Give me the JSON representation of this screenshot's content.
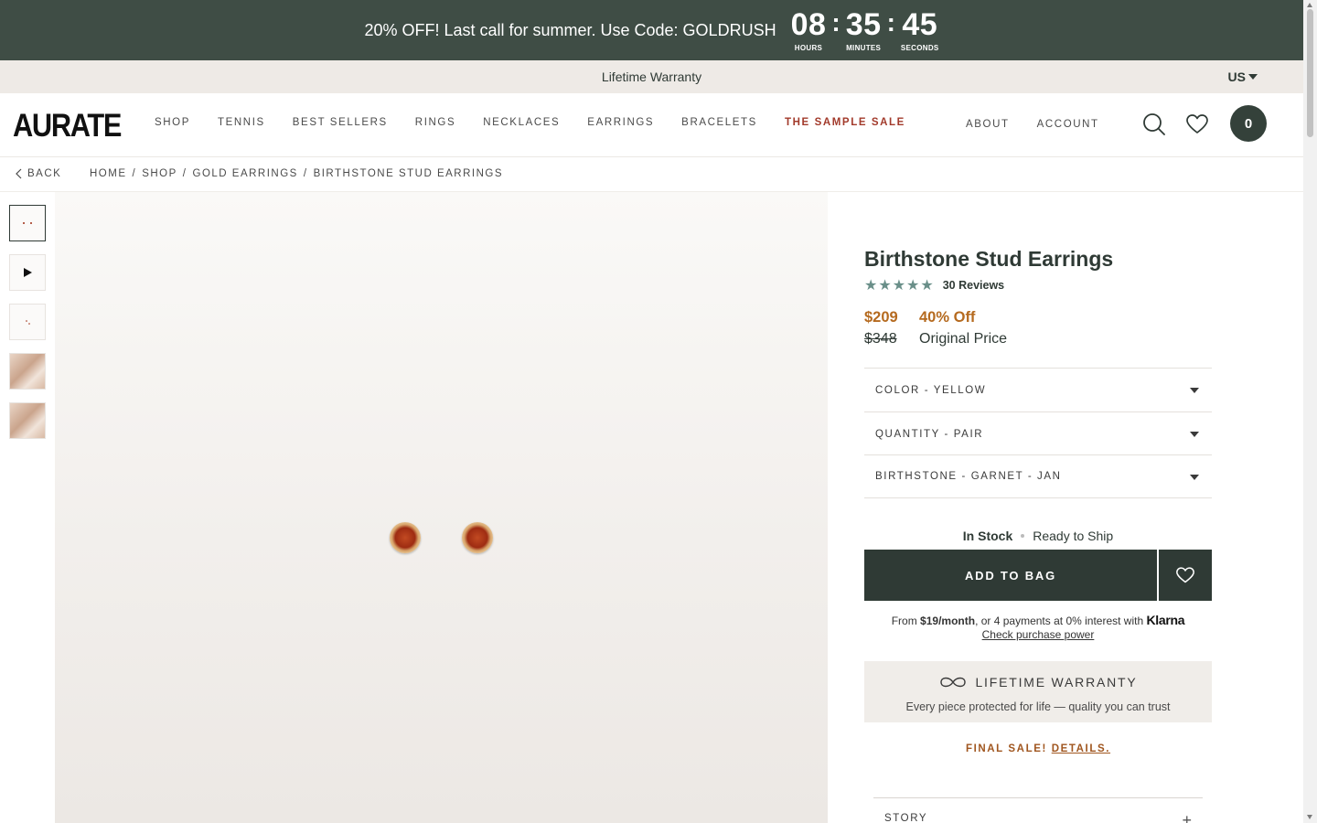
{
  "promo": {
    "text": "20% OFF! Last call for summer. Use Code: GOLDRUSH",
    "hours": "08",
    "minutes": "35",
    "seconds": "45",
    "hours_label": "HOURS",
    "minutes_label": "MINUTES",
    "seconds_label": "SECONDS",
    "separator": ":"
  },
  "strip": {
    "text": "Lifetime Warranty",
    "locale": "US"
  },
  "header": {
    "logo": "AURATE",
    "nav": [
      "SHOP",
      "TENNIS",
      "BEST SELLERS",
      "RINGS",
      "NECKLACES",
      "EARRINGS",
      "BRACELETS",
      "THE SAMPLE SALE"
    ],
    "secondary_nav": [
      "ABOUT",
      "ACCOUNT"
    ],
    "bag_count": "0",
    "icons": [
      "search-icon",
      "heart-icon",
      "bag-icon"
    ]
  },
  "breadcrumb": {
    "back": "BACK",
    "items": [
      "HOME",
      "SHOP",
      "GOLD EARRINGS",
      "BIRTHSTONE STUD EARRINGS"
    ],
    "separator": "/"
  },
  "product": {
    "title": "Birthstone Stud Earrings",
    "rating_stars": 5,
    "reviews": "30 Reviews",
    "price": "$209",
    "discount": "40% Off",
    "original_price": "$348",
    "original_label": "Original Price",
    "options": [
      "COLOR - YELLOW",
      "QUANTITY - PAIR",
      "BIRTHSTONE - GARNET - JAN"
    ],
    "stock_status": "In Stock",
    "ship_status": "Ready to Ship",
    "add_to_bag": "ADD TO BAG",
    "klarna_prefix": "From",
    "klarna_amount": "$19/month",
    "klarna_suffix": ", or 4 payments at 0% interest with",
    "klarna_brand": "Klarna",
    "klarna_link": "Check purchase power",
    "warranty_title": "LIFETIME WARRANTY",
    "warranty_sub": "Every piece protected for life — quality you can trust",
    "final_sale": "FINAL SALE!",
    "final_sale_link": "DETAILS.",
    "story": "STORY"
  },
  "colors": {
    "promo_bg": "#3f4d45",
    "primary": "#2f3a35",
    "sale_red": "#a23a2b",
    "price_orange": "#b56a1f",
    "star_teal": "#6a8f89",
    "strip_bg": "#eeeae6"
  }
}
